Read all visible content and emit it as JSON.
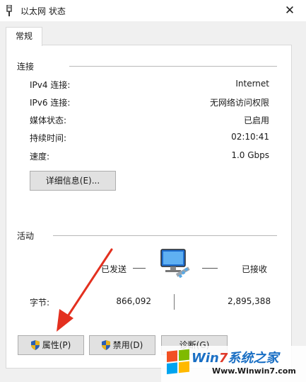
{
  "window": {
    "title": "以太网 状态",
    "close_glyph": "✕"
  },
  "tabs": [
    {
      "label": "常规"
    }
  ],
  "connection": {
    "heading": "连接",
    "rows": [
      {
        "label": "IPv4 连接:",
        "value": "Internet"
      },
      {
        "label": "IPv6 连接:",
        "value": "无网络访问权限"
      },
      {
        "label": "媒体状态:",
        "value": "已启用"
      },
      {
        "label": "持续时间:",
        "value": "02:10:41"
      },
      {
        "label": "速度:",
        "value": "1.0 Gbps"
      }
    ],
    "details_button": "详细信息(E)..."
  },
  "activity": {
    "heading": "活动",
    "sent_label": "已发送",
    "received_label": "已接收",
    "bytes_label": "字节:",
    "bytes_sent": "866,092",
    "bytes_received": "2,895,388"
  },
  "buttons": {
    "properties": "属性(P)",
    "disable": "禁用(D)",
    "diagnose": "诊断(G)"
  },
  "watermark": {
    "brand_prefix": "Win",
    "brand_seven": "7",
    "brand_suffix": "系统之家",
    "url": "Www.Winwin7.com"
  },
  "colors": {
    "annotation_arrow": "#e3301f",
    "shield_blue": "#2b5fb5",
    "shield_gold": "#e8b21d"
  }
}
